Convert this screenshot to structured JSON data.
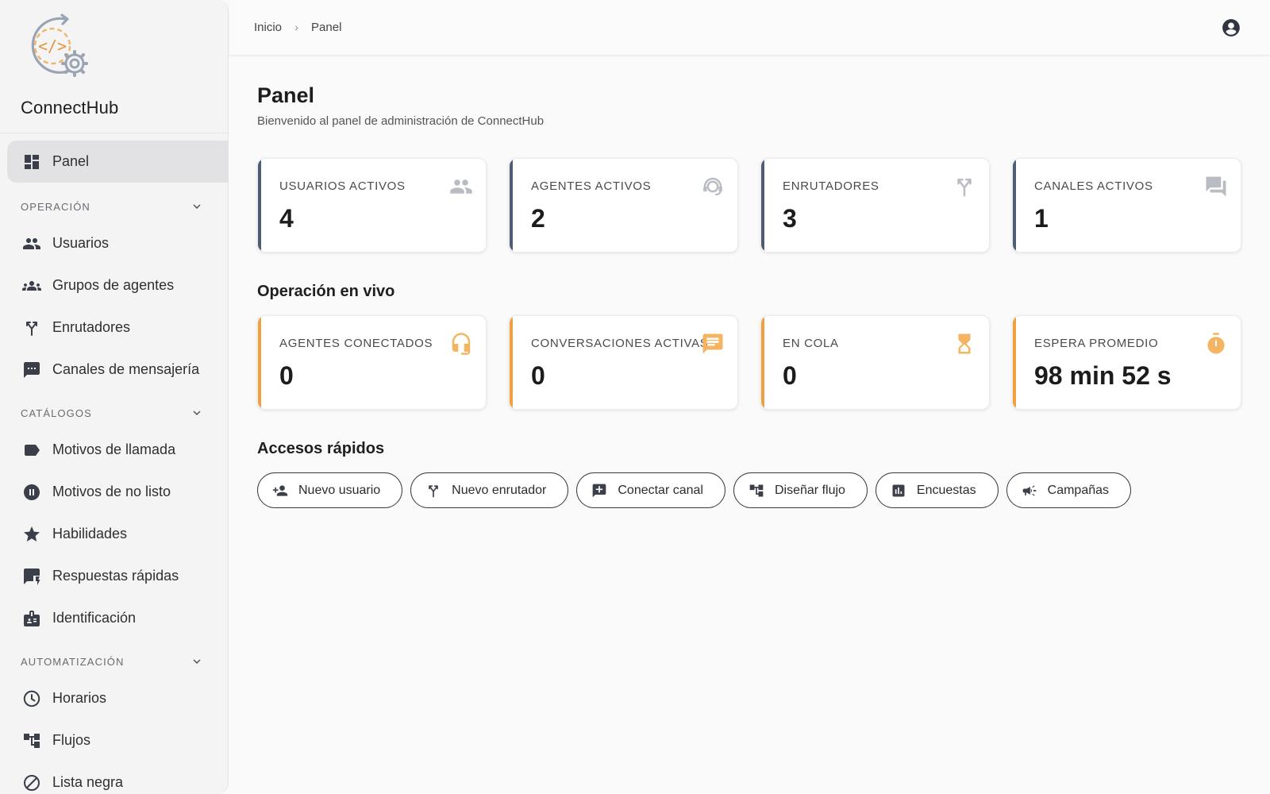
{
  "brand": {
    "name": "ConnectHub"
  },
  "breadcrumb": {
    "home": "Inicio",
    "current": "Panel"
  },
  "sidebar": {
    "panel": {
      "label": "Panel",
      "icon": "dashboard-icon"
    },
    "sections": [
      {
        "title": "OPERACIÓN",
        "items": [
          {
            "label": "Usuarios",
            "icon": "people-icon"
          },
          {
            "label": "Grupos de agentes",
            "icon": "groups-icon"
          },
          {
            "label": "Enrutadores",
            "icon": "router-icon"
          },
          {
            "label": "Canales de mensajería",
            "icon": "chat-icon"
          }
        ]
      },
      {
        "title": "CATÁLOGOS",
        "items": [
          {
            "label": "Motivos de llamada",
            "icon": "label-icon"
          },
          {
            "label": "Motivos de no listo",
            "icon": "pause-icon"
          },
          {
            "label": "Habilidades",
            "icon": "star-icon"
          },
          {
            "label": "Respuestas rápidas",
            "icon": "quickreply-icon"
          },
          {
            "label": "Identificación",
            "icon": "badge-icon"
          }
        ]
      },
      {
        "title": "AUTOMATIZACIÓN",
        "items": [
          {
            "label": "Horarios",
            "icon": "clock-icon"
          },
          {
            "label": "Flujos",
            "icon": "flow-icon"
          },
          {
            "label": "Lista negra",
            "icon": "block-icon"
          }
        ]
      }
    ]
  },
  "main": {
    "title": "Panel",
    "subtitle": "Bienvenido al panel de administración de ConnectHub",
    "stats": [
      {
        "label": "USUARIOS ACTIVOS",
        "value": "4",
        "icon": "people-icon"
      },
      {
        "label": "AGENTES ACTIVOS",
        "value": "2",
        "icon": "support-agent-icon"
      },
      {
        "label": "ENRUTADORES",
        "value": "3",
        "icon": "router-icon"
      },
      {
        "label": "CANALES ACTIVOS",
        "value": "1",
        "icon": "forum-icon"
      }
    ],
    "live_title": "Operación en vivo",
    "live": [
      {
        "label": "AGENTES CONECTADOS",
        "value": "0",
        "icon": "headset-icon"
      },
      {
        "label": "CONVERSACIONES ACTIVAS",
        "value": "0",
        "icon": "message-icon"
      },
      {
        "label": "EN COLA",
        "value": "0",
        "icon": "hourglass-icon"
      },
      {
        "label": "ESPERA PROMEDIO",
        "value": "98 min 52 s",
        "icon": "timer-icon"
      }
    ],
    "quick_title": "Accesos rápidos",
    "quick": [
      {
        "label": "Nuevo usuario",
        "icon": "person-add-icon"
      },
      {
        "label": "Nuevo enrutador",
        "icon": "router-icon"
      },
      {
        "label": "Conectar canal",
        "icon": "add-box-icon"
      },
      {
        "label": "Diseñar flujo",
        "icon": "flow-icon"
      },
      {
        "label": "Encuestas",
        "icon": "poll-icon"
      },
      {
        "label": "Campañas",
        "icon": "campaign-icon"
      }
    ]
  },
  "colors": {
    "stat_accent": "#4f5d72",
    "live_accent": "#f0a03c",
    "stat_icon": "#b9bcc2",
    "live_icon": "#f3b562"
  }
}
